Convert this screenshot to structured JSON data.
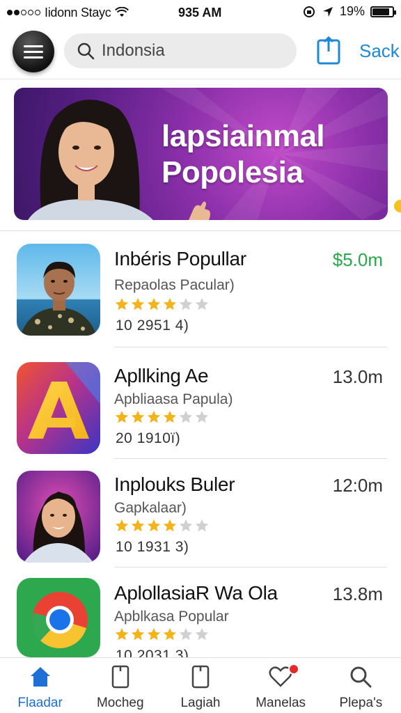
{
  "status_bar": {
    "carrier": "Iidonn Stayc",
    "time": "935 AM",
    "battery": "19%",
    "battery_level": 0.85
  },
  "header": {
    "search": {
      "value": "Indonsia",
      "placeholder": "Indonsia"
    },
    "action_link": "Sack",
    "accent": "#1e88d6"
  },
  "banner": {
    "title_line1": "lapsiainmal",
    "title_line2": "Popolesia",
    "colors": {
      "from": "#c14bc9",
      "to": "#3d1868"
    }
  },
  "apps": [
    {
      "name": "Inbéris Popullar",
      "price": "$5.0m",
      "category": "Repaolas Pacular)",
      "rating": 4,
      "reviews": "10  2951 4)",
      "icon": "person-portrait-icon"
    },
    {
      "name": "Apllking Ae",
      "price": "13.0m",
      "category": "Apbliaasa Papula)",
      "rating": 4,
      "reviews": "20  1910ї)",
      "icon": "letter-a-logo-icon"
    },
    {
      "name": "Inplouks Buler",
      "price": "12:0m",
      "category": "Gapkalaar)",
      "rating": 4,
      "reviews": "10  1931 3)",
      "icon": "woman-portrait-icon"
    },
    {
      "name": "AplollasiaR Wa Ola",
      "price": "13.8m",
      "category": "Apblkasа Popular",
      "rating": 4,
      "reviews": "10  2031 3)",
      "icon": "chrome-like-icon"
    }
  ],
  "bottom_nav": [
    {
      "label": "Flaadar",
      "icon": "home-icon",
      "active": true
    },
    {
      "label": "Mocheg",
      "icon": "tablet-icon",
      "active": false
    },
    {
      "label": "Lagiah",
      "icon": "tablet-icon",
      "active": false
    },
    {
      "label": "Manelas",
      "icon": "heart-icon",
      "active": false,
      "badge": true
    },
    {
      "label": "Plepa's",
      "icon": "search-icon",
      "active": false
    }
  ],
  "colors": {
    "star": "#f3b41b",
    "star_empty": "#d0d0d0",
    "price_green": "#2aa84a",
    "nav_active": "#1e6fd6"
  }
}
